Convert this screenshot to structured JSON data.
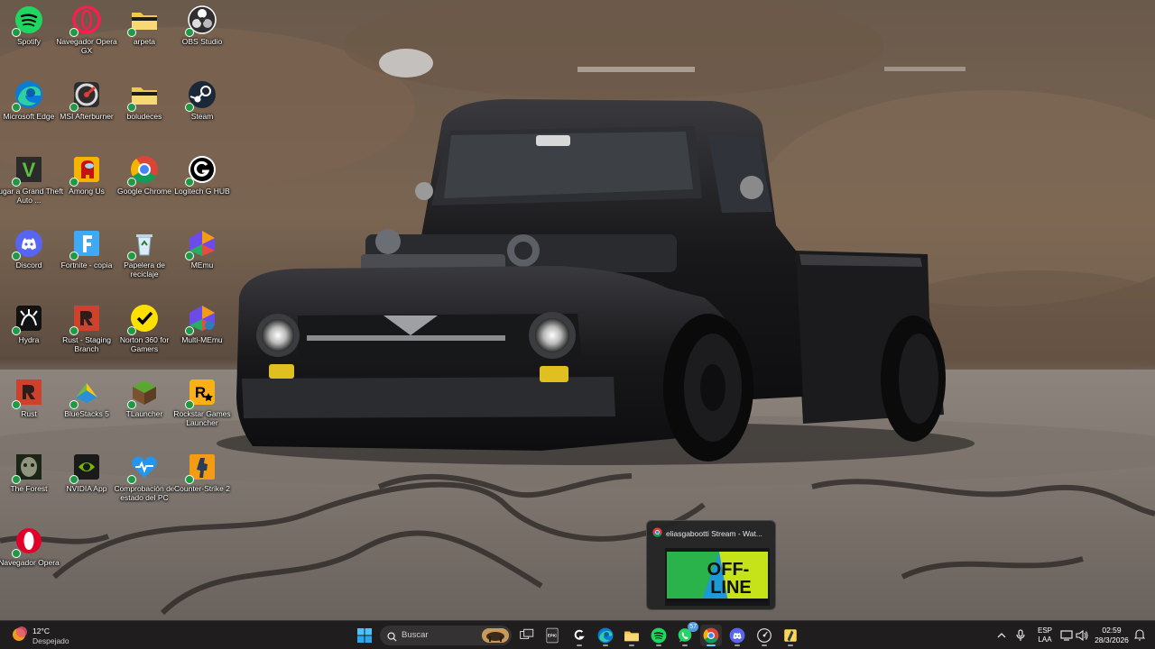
{
  "desktop": {
    "icons": [
      {
        "label": "Spotify",
        "icon": "spotify-icon"
      },
      {
        "label": "Navegador Opera GX",
        "icon": "opera-gx-icon"
      },
      {
        "label": "arpeta",
        "icon": "folder-icon"
      },
      {
        "label": "OBS Studio",
        "icon": "obs-icon"
      },
      {
        "label": "Microsoft Edge",
        "icon": "edge-icon"
      },
      {
        "label": "MSI Afterburner",
        "icon": "msi-afterburner-icon"
      },
      {
        "label": "boludeces",
        "icon": "folder-icon"
      },
      {
        "label": "Steam",
        "icon": "steam-icon"
      },
      {
        "label": "Jugar a Grand Theft Auto ...",
        "icon": "gta-icon"
      },
      {
        "label": "Among Us",
        "icon": "among-us-icon"
      },
      {
        "label": "Google Chrome",
        "icon": "chrome-icon"
      },
      {
        "label": "Logitech G HUB",
        "icon": "logitech-icon"
      },
      {
        "label": "Discord",
        "icon": "discord-icon"
      },
      {
        "label": "Fortnite - copia",
        "icon": "fortnite-icon"
      },
      {
        "label": "Papelera de reciclaje",
        "icon": "recycle-bin-icon"
      },
      {
        "label": "MEmu",
        "icon": "memu-icon"
      },
      {
        "label": "Hydra",
        "icon": "hydra-icon"
      },
      {
        "label": "Rust - Staging Branch",
        "icon": "rust-icon"
      },
      {
        "label": "Norton 360 for Gamers",
        "icon": "norton-icon"
      },
      {
        "label": "Multi-MEmu",
        "icon": "multi-memu-icon"
      },
      {
        "label": "Rust",
        "icon": "rust-icon"
      },
      {
        "label": "BlueStacks 5",
        "icon": "bluestacks-icon"
      },
      {
        "label": "TLauncher",
        "icon": "tlauncher-icon"
      },
      {
        "label": "Rockstar Games Launcher",
        "icon": "rockstar-icon"
      },
      {
        "label": "The Forest",
        "icon": "the-forest-icon"
      },
      {
        "label": "NVIDIA App",
        "icon": "nvidia-icon"
      },
      {
        "label": "Comprobación de estado del PC",
        "icon": "pc-health-icon"
      },
      {
        "label": "Counter-Strike 2",
        "icon": "cs2-icon"
      },
      {
        "label": "Navegador Opera",
        "icon": "opera-icon"
      }
    ]
  },
  "preview": {
    "title": "eliasgabootti Stream - Wat...",
    "thumb_line1": "OFF-",
    "thumb_line2": "LINE"
  },
  "taskbar": {
    "weather": {
      "temp": "12°C",
      "condition": "Despejado"
    },
    "search_placeholder": "Buscar",
    "apps": [
      {
        "icon": "windows-start-icon"
      },
      {
        "icon": "task-view-icon"
      },
      {
        "icon": "epic-games-icon",
        "text": "EPIC"
      },
      {
        "icon": "logitech-icon"
      },
      {
        "icon": "edge-icon"
      },
      {
        "icon": "file-explorer-icon"
      },
      {
        "icon": "spotify-icon"
      },
      {
        "icon": "whatsapp-icon",
        "badge": "57"
      },
      {
        "icon": "chrome-icon"
      },
      {
        "icon": "discord-icon"
      },
      {
        "icon": "steam-overlay-icon"
      },
      {
        "icon": "app-icon"
      }
    ],
    "tray": {
      "lang1": "ESP",
      "lang2": "LAA",
      "time": "02:59",
      "date": "28/3/2026"
    }
  },
  "colors": {
    "taskbar": "#1f1d1d",
    "accent": "#60cdff"
  }
}
